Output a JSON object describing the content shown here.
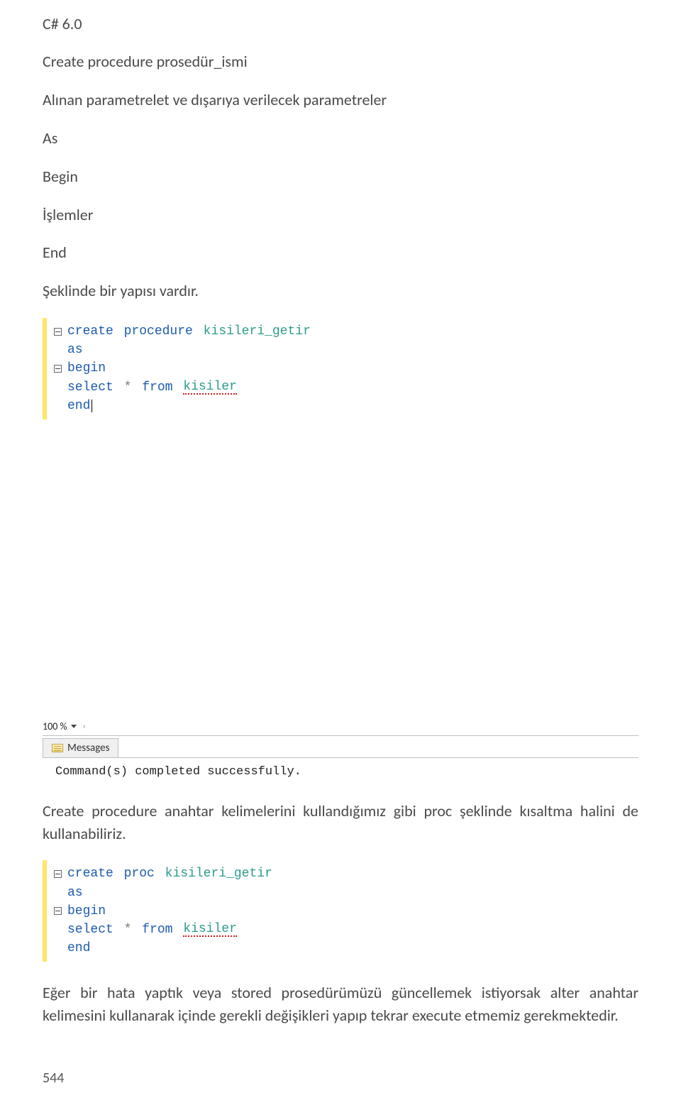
{
  "header": {
    "title": "C# 6.0"
  },
  "intro": {
    "line1": "Create procedure prosedür_ismi",
    "line2": "Alınan parametrelet ve dışarıya verilecek parametreler",
    "line3": "As",
    "line4": "Begin",
    "line5": "İşlemler",
    "line6": "End",
    "line7": "Şeklinde bir yapısı vardır."
  },
  "code1": {
    "l1_a": "create",
    "l1_b": "procedure",
    "l1_c": "kisileri_getir",
    "l2": "as",
    "l3": "begin",
    "l4_a": "select",
    "l4_b": "*",
    "l4_c": "from",
    "l4_d": "kisiler",
    "l5": "end"
  },
  "editor": {
    "zoom": "100 %",
    "messages_tab": "Messages",
    "messages_body": "Command(s) completed successfully."
  },
  "mid_text": "Create procedure anahtar kelimelerini kullandığımız gibi proc şeklinde kısaltma halini de kullanabiliriz.",
  "code2": {
    "l1_a": "create",
    "l1_b": "proc",
    "l1_c": "kisileri_getir",
    "l2": "as",
    "l3": "begin",
    "l4_a": "select",
    "l4_b": "*",
    "l4_c": "from",
    "l4_d": "kisiler",
    "l5": "end"
  },
  "end_text": "Eğer bir hata yaptık veya stored prosedürümüzü güncellemek istiyorsak alter anahtar kelimesini kullanarak içinde gerekli değişikleri yapıp tekrar execute etmemiz gerekmektedir.",
  "page_number": "544"
}
